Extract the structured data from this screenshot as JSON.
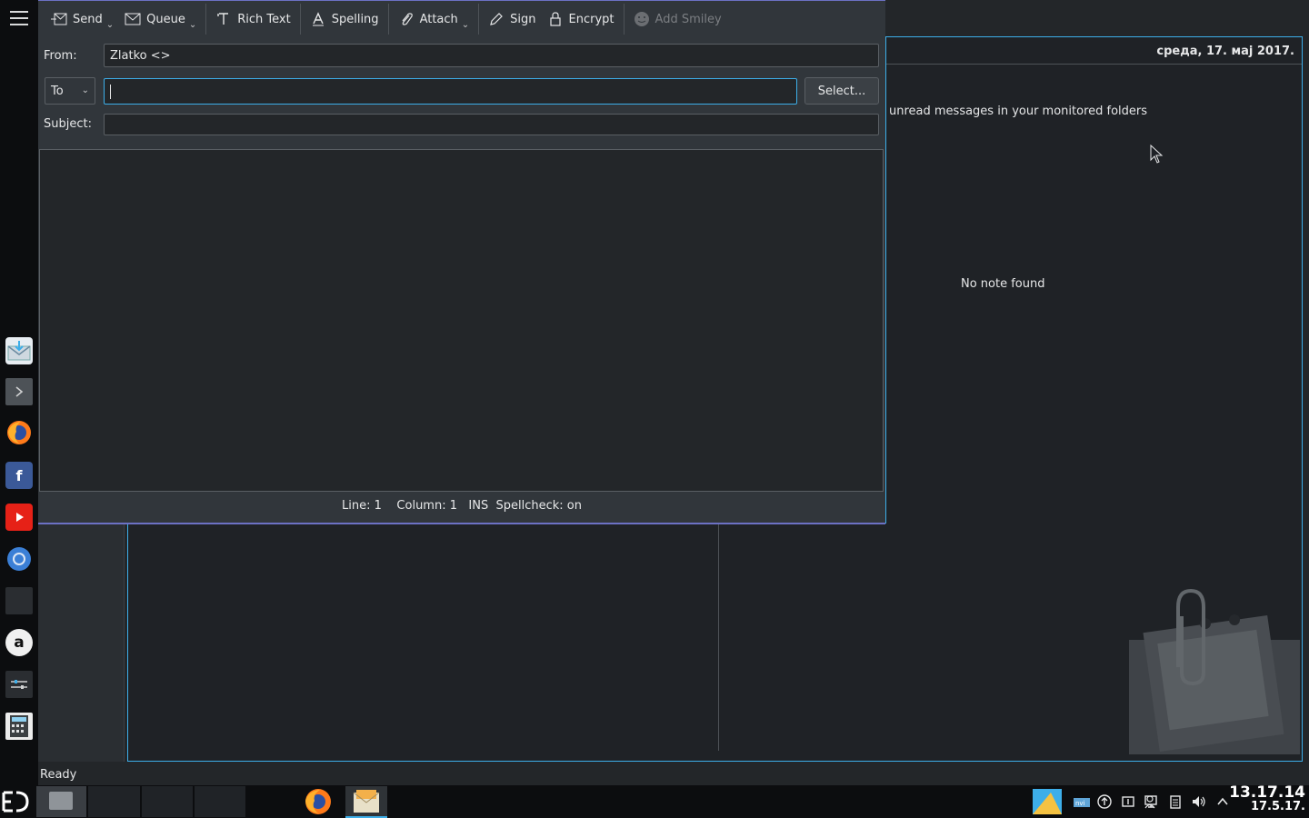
{
  "composer": {
    "toolbar": {
      "send": "Send",
      "queue": "Queue",
      "rich_text": "Rich Text",
      "spelling": "Spelling",
      "attach": "Attach",
      "sign": "Sign",
      "encrypt": "Encrypt",
      "add_smiley": "Add Smiley"
    },
    "from_label": "From:",
    "from_value": "Zlatko <>",
    "recipient_type": "To",
    "recipient_value": "",
    "select_button": "Select...",
    "subject_label": "Subject:",
    "subject_value": "",
    "body": "",
    "status": {
      "line": "Line: 1",
      "column": "Column: 1",
      "mode": "INS",
      "spellcheck": "Spellcheck: on"
    }
  },
  "main_window": {
    "date_header": "среда, 17. мај 2017.",
    "unread_text": "unread messages in your monitored folders",
    "no_note": "No note found",
    "status": "Ready"
  },
  "taskbar": {
    "clock_time": "13.17.14",
    "clock_date": "17.5.17."
  },
  "dock": {
    "icons": [
      "kmail-icon",
      "terminal-icon",
      "firefox-icon",
      "facebook-icon",
      "youtube-icon",
      "chrome-icon",
      "blank-app-icon",
      "amazon-icon",
      "settings-icon",
      "calculator-icon"
    ]
  },
  "colors": {
    "accent": "#3daee9",
    "composer_border": "#6c71c4",
    "window_bg": "#31363b",
    "field_bg": "#232629"
  }
}
